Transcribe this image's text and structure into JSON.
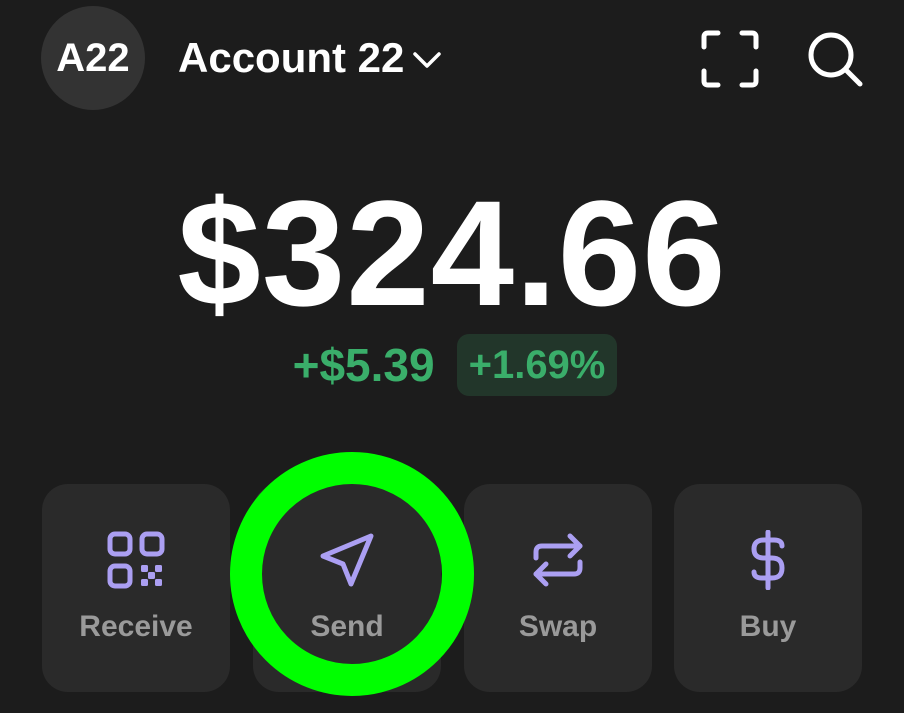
{
  "header": {
    "avatar_text": "A22",
    "account_name": "Account 22",
    "icons": {
      "account_dropdown": "chevron-down-icon",
      "scan": "scan-icon",
      "search": "search-icon"
    }
  },
  "balance": {
    "total": "$324.66",
    "change_amount": "+$5.39",
    "change_percent": "+1.69%"
  },
  "actions": [
    {
      "label": "Receive",
      "icon": "qr-code-icon"
    },
    {
      "label": "Send",
      "icon": "send-icon"
    },
    {
      "label": "Swap",
      "icon": "swap-icon"
    },
    {
      "label": "Buy",
      "icon": "dollar-icon"
    }
  ],
  "colors": {
    "background": "#1c1c1c",
    "card": "#2a2a2a",
    "accent_purple": "#ab9ff2",
    "positive_green": "#3aae6a",
    "positive_badge_bg": "#22362a",
    "highlight_ring": "#00ff00",
    "label_gray": "#9a9a9a"
  }
}
